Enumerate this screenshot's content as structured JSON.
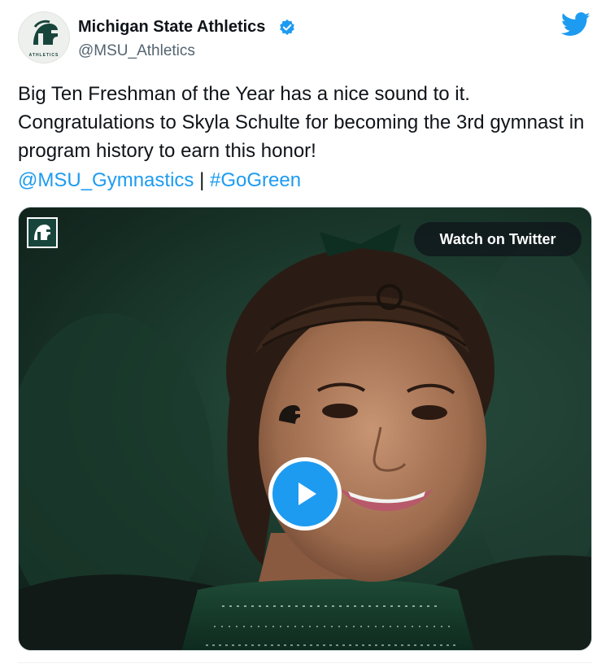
{
  "author": {
    "display_name": "Michigan State Athletics",
    "handle": "@MSU_Athletics",
    "avatar_text": "ATHLETICS",
    "verified": true
  },
  "tweet": {
    "text": "Big Ten Freshman of the Year has a nice sound to it. Congratulations to Skyla Schulte for becoming the 3rd gymnast in program history to earn this honor!",
    "mention": "@MSU_Gymnastics",
    "separator": "|",
    "hashtag": "#GoGreen"
  },
  "media": {
    "watch_label": "Watch on Twitter"
  },
  "icons": {
    "brand": "twitter-bird-icon",
    "verified": "verified-badge-icon",
    "play": "play-icon",
    "logo": "spartan-logo-icon"
  },
  "colors": {
    "link": "#1d9bf0",
    "verified": "#1d9bf0",
    "brand": "#1d9bf0",
    "msu_green": "#18453b"
  }
}
